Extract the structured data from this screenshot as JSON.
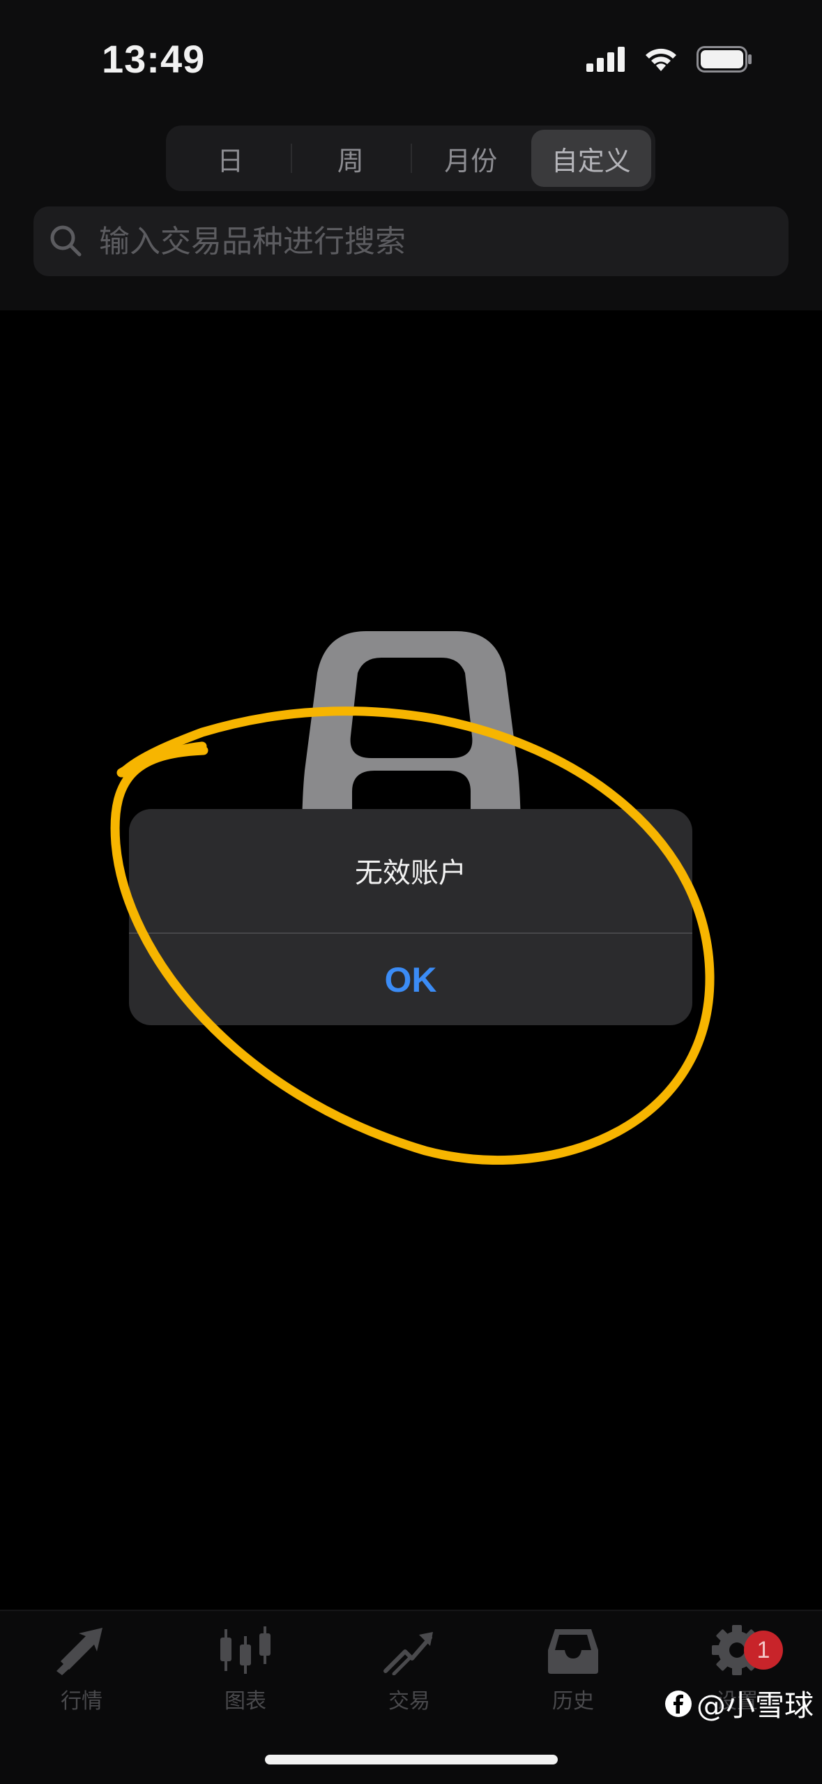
{
  "status_bar": {
    "time": "13:49"
  },
  "segmented_control": {
    "items": [
      "日",
      "周",
      "月份",
      "自定义"
    ],
    "selected": "自定义"
  },
  "search": {
    "placeholder": "输入交易品种进行搜索"
  },
  "alert": {
    "message": "无效账户",
    "ok_label": "OK"
  },
  "tab_bar": {
    "items": [
      {
        "label": "行情",
        "icon": "quotes-arrows-icon"
      },
      {
        "label": "图表",
        "icon": "candlestick-chart-icon"
      },
      {
        "label": "交易",
        "icon": "trade-trend-icon"
      },
      {
        "label": "历史",
        "icon": "history-inbox-icon"
      },
      {
        "label": "设置",
        "icon": "gear-icon"
      }
    ],
    "settings_badge": "1"
  },
  "watermark": {
    "text": "@小雪球"
  },
  "colors": {
    "accent_blue": "#3b8cf6",
    "annotation_yellow": "#f7b500",
    "badge_red": "#c8242a"
  }
}
